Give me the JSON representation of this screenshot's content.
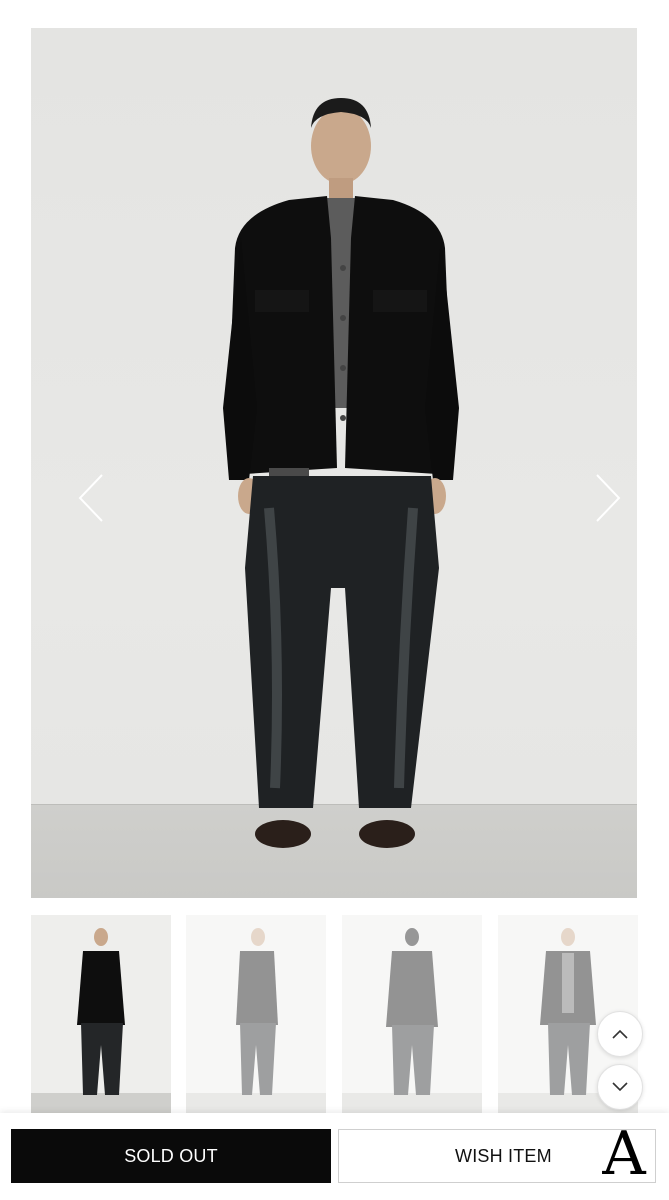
{
  "product_gallery": {
    "main_image": {
      "alt": "model-wearing-black-jacket-and-washed-black-denim"
    },
    "prev_arrow_icon": "chevron-left-icon",
    "next_arrow_icon": "chevron-right-icon",
    "thumbnails": [
      {
        "view": "front",
        "active": true
      },
      {
        "view": "side",
        "active": false
      },
      {
        "view": "back",
        "active": false
      },
      {
        "view": "front-open",
        "active": false
      }
    ]
  },
  "scroll_controls": {
    "up_icon": "chevron-up-icon",
    "down_icon": "chevron-down-icon"
  },
  "bottom_bar": {
    "sold_out_label": "SOLD OUT",
    "wish_label": "WISH ITEM",
    "brand_logo": "A"
  },
  "colors": {
    "primary_button_bg": "#0a0a0a",
    "primary_button_text": "#ffffff",
    "secondary_button_border": "#cfcfcf",
    "backdrop": "#e6e6e4"
  }
}
